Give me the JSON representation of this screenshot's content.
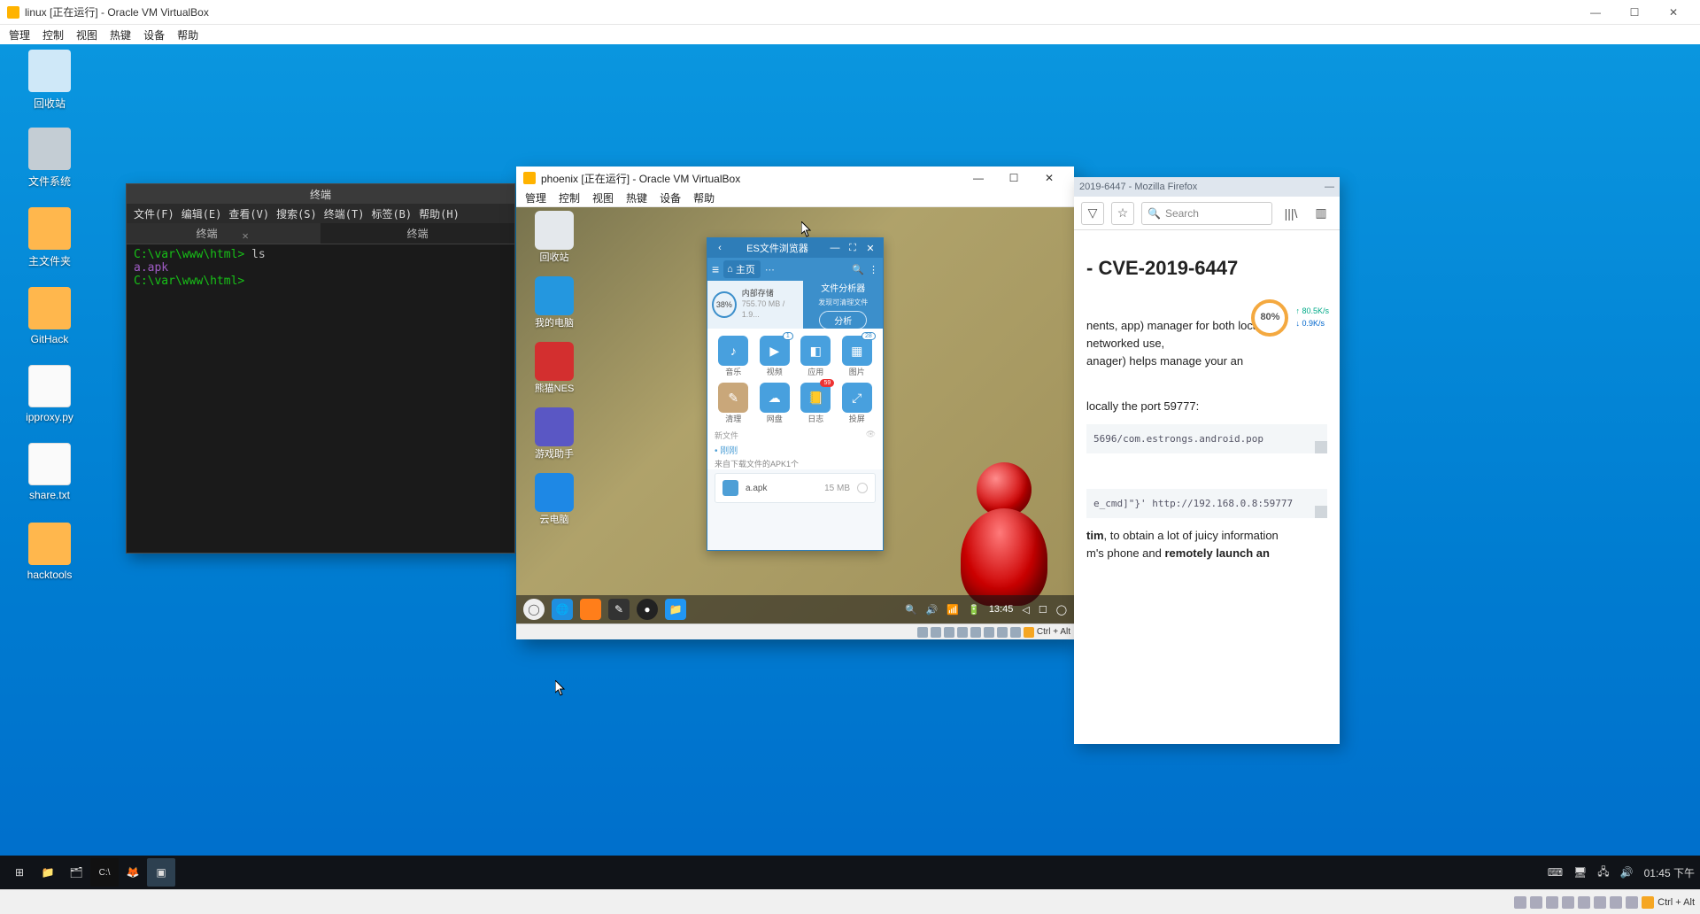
{
  "host": {
    "title": "linux [正在运行] - Oracle VM VirtualBox",
    "menu": [
      "管理",
      "控制",
      "视图",
      "热键",
      "设备",
      "帮助"
    ],
    "status_key": "Ctrl + Alt",
    "desktop_icons": [
      {
        "label": "回收站",
        "kind": "trash"
      },
      {
        "label": "文件系统",
        "kind": "disk"
      },
      {
        "label": "主文件夹",
        "kind": "folder"
      },
      {
        "label": "GitHack",
        "kind": "folder"
      },
      {
        "label": "ipproxy.py",
        "kind": "file"
      },
      {
        "label": "share.txt",
        "kind": "file"
      },
      {
        "label": "hacktools",
        "kind": "folder"
      }
    ]
  },
  "terminal": {
    "title": "终端",
    "menu": [
      "文件(F)",
      "编辑(E)",
      "查看(V)",
      "搜索(S)",
      "终端(T)",
      "标签(B)",
      "帮助(H)"
    ],
    "tabs": [
      "终端",
      "终端"
    ],
    "lines": [
      {
        "ps": "C:\\var\\www\\html>",
        "cmd": "ls"
      },
      {
        "out": "a.apk"
      },
      {
        "ps": "C:\\var\\www\\html>",
        "cmd": ""
      }
    ]
  },
  "phoenix": {
    "title": "phoenix [正在运行] - Oracle VM VirtualBox",
    "menu": [
      "管理",
      "控制",
      "视图",
      "热键",
      "设备",
      "帮助"
    ],
    "status_key": "Ctrl + Alt",
    "clock": "13:45",
    "desktop_icons": [
      {
        "label": "回收站",
        "color": "#e4e8ec"
      },
      {
        "label": "我的电脑",
        "color": "#2497df"
      },
      {
        "label": "熊猫NES",
        "color": "#d32f2f"
      },
      {
        "label": "游戏助手",
        "color": "#5a57c4"
      },
      {
        "label": "云电脑",
        "color": "#1e88e5"
      }
    ],
    "es": {
      "title": "ES文件浏览器",
      "home_label": "主页",
      "storage_pct": "38%",
      "storage_name": "内部存储",
      "storage_size": "755.70 MB / 1.9...",
      "analyzer_title": "文件分析器",
      "analyzer_sub": "发现可清理文件",
      "analyze_btn": "分析",
      "grid": [
        {
          "label": "音乐",
          "icon": "♪",
          "badge": ""
        },
        {
          "label": "视频",
          "icon": "▶",
          "badge": "1"
        },
        {
          "label": "应用",
          "icon": "◧",
          "badge": ""
        },
        {
          "label": "图片",
          "icon": "▦",
          "badge": "28"
        },
        {
          "label": "清理",
          "icon": "✎",
          "badge": "",
          "alt": true
        },
        {
          "label": "网盘",
          "icon": "☁",
          "badge": ""
        },
        {
          "label": "日志",
          "icon": "📒",
          "badge": "59",
          "red": true
        },
        {
          "label": "投屏",
          "icon": "⤢",
          "badge": ""
        }
      ],
      "new_files": "新文件",
      "just_now": "刚刚",
      "apk_note": "来自下载文件的APK1个",
      "file_name": "a.apk",
      "file_size": "15 MB"
    }
  },
  "firefox": {
    "titlebar": "2019-6447 - Mozilla Firefox",
    "search_ph": "Search",
    "heading_suffix": " - CVE-2019-6447",
    "para1": "nents, app) manager for both local and networked use,",
    "para1b": "anager) helps manage your an",
    "para2": "locally the port 59777:",
    "code1": "5696/com.estrongs.android.pop",
    "code2": "e_cmd]\"}' http://192.168.0.8:59777",
    "para3_a": "tim",
    "para3_b": ", to obtain a lot of juicy information",
    "para3_c": "m's phone and ",
    "para3_d": "remotely launch an",
    "speed_pct": "80%",
    "speed_up": "80.5K/s",
    "speed_dn": "0.9K/s"
  },
  "taskbar": {
    "clock": "01:45 下午"
  }
}
